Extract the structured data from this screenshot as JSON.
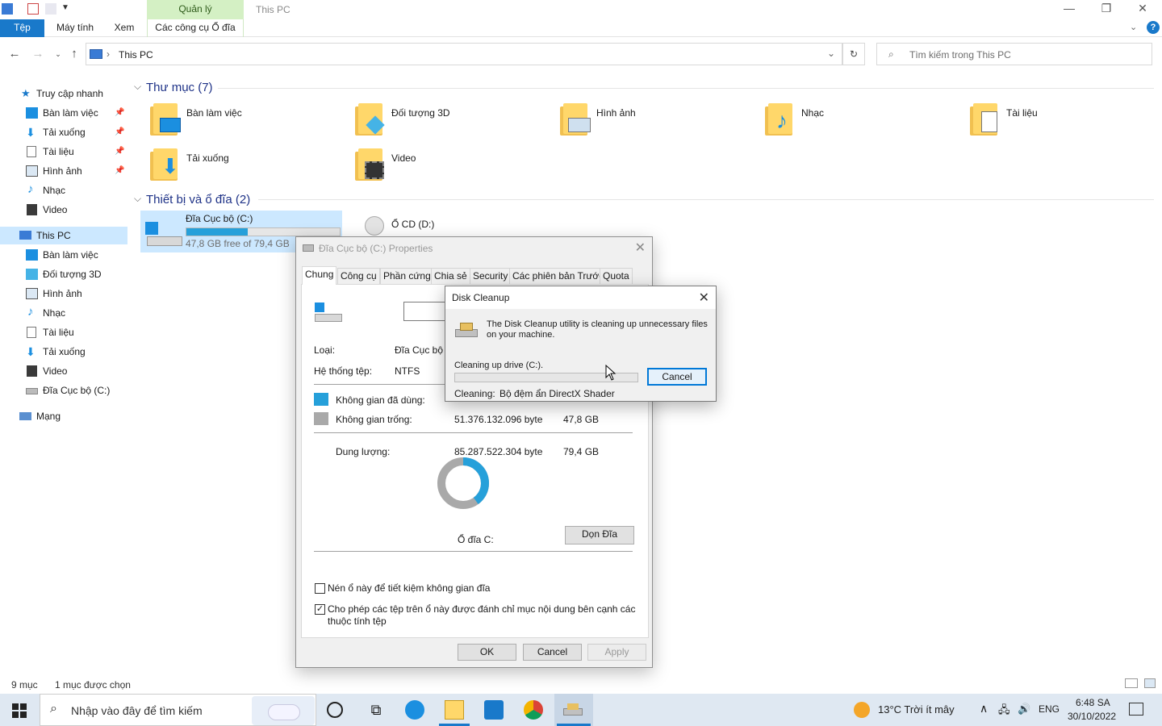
{
  "titlebar": {
    "context_tab": "Quản lý",
    "title": "This PC",
    "minimize": "—",
    "maximize": "❐",
    "close": "✕"
  },
  "ribbon": {
    "tabs": [
      "Tệp",
      "Máy tính",
      "Xem",
      "Các công cụ Ổ đĩa"
    ]
  },
  "address": {
    "path": "This PC",
    "search_placeholder": "Tìm kiếm trong This PC"
  },
  "sidebar": {
    "quick_access": "Truy cập nhanh",
    "quick_items": [
      "Bàn làm việc",
      "Tải xuống",
      "Tài liệu",
      "Hình ảnh",
      "Nhạc",
      "Video"
    ],
    "this_pc": "This PC",
    "pc_items": [
      "Bàn làm việc",
      "Đối tượng 3D",
      "Hình ảnh",
      "Nhạc",
      "Tài liệu",
      "Tải xuống",
      "Video",
      "Đĩa Cục bộ (C:)"
    ],
    "network": "Mạng"
  },
  "main": {
    "folders_header": "Thư mục (7)",
    "folders": [
      "Bàn làm việc",
      "Đối tượng 3D",
      "Hình ảnh",
      "Nhạc",
      "Tài liệu",
      "Tải xuống",
      "Video"
    ],
    "devices_header": "Thiết bị và ổ đĩa (2)",
    "drive_c": {
      "name": "Đĩa Cục bộ (C:)",
      "free_text": "47,8 GB free of 79,4 GB",
      "used_fraction": 0.4
    },
    "drive_d": "Ổ CD (D:)"
  },
  "properties": {
    "title": "Đĩa Cục bộ (C:) Properties",
    "tabs": [
      "Chung",
      "Công cụ",
      "Phần cứng",
      "Chia sẻ",
      "Security",
      "Các phiên bản Trước",
      "Quota"
    ],
    "type_label": "Loại:",
    "type_value": "Đĩa Cục bộ",
    "fs_label": "Hệ thống tệp:",
    "fs_value": "NTFS",
    "used_label": "Không gian đã dùng:",
    "free_label": "Không gian trống:",
    "free_bytes": "51.376.132.096 byte",
    "free_gb": "47,8 GB",
    "capacity_label": "Dung lượng:",
    "capacity_bytes": "85.287.522.304 byte",
    "capacity_gb": "79,4 GB",
    "drive_label": "Ổ đĩa C:",
    "cleanup_button": "Dọn Đĩa",
    "compress_label": "Nén ổ này để tiết kiệm không gian đĩa",
    "index_label": "Cho phép các tệp trên ổ này được đánh chỉ mục nội dung bên cạnh các thuộc tính tệp",
    "ok": "OK",
    "cancel": "Cancel",
    "apply": "Apply",
    "used_color": "#26a0da",
    "free_color": "#a9a9a9"
  },
  "disk_cleanup": {
    "title": "Disk Cleanup",
    "message": "The Disk Cleanup utility is cleaning up unnecessary files on your machine.",
    "drive_text": "Cleaning up drive  (C:).",
    "cancel": "Cancel",
    "cleaning_label": "Cleaning:",
    "cleaning_item": "Bộ đệm ẩn DirectX Shader"
  },
  "statusbar": {
    "items": "9 mục",
    "selected": "1 mục được chọn"
  },
  "taskbar": {
    "search_placeholder": "Nhập vào đây để tìm kiếm",
    "weather": "13°C  Trời ít mây",
    "lang": "ENG",
    "time": "6:48 SA",
    "date": "30/10/2022"
  }
}
